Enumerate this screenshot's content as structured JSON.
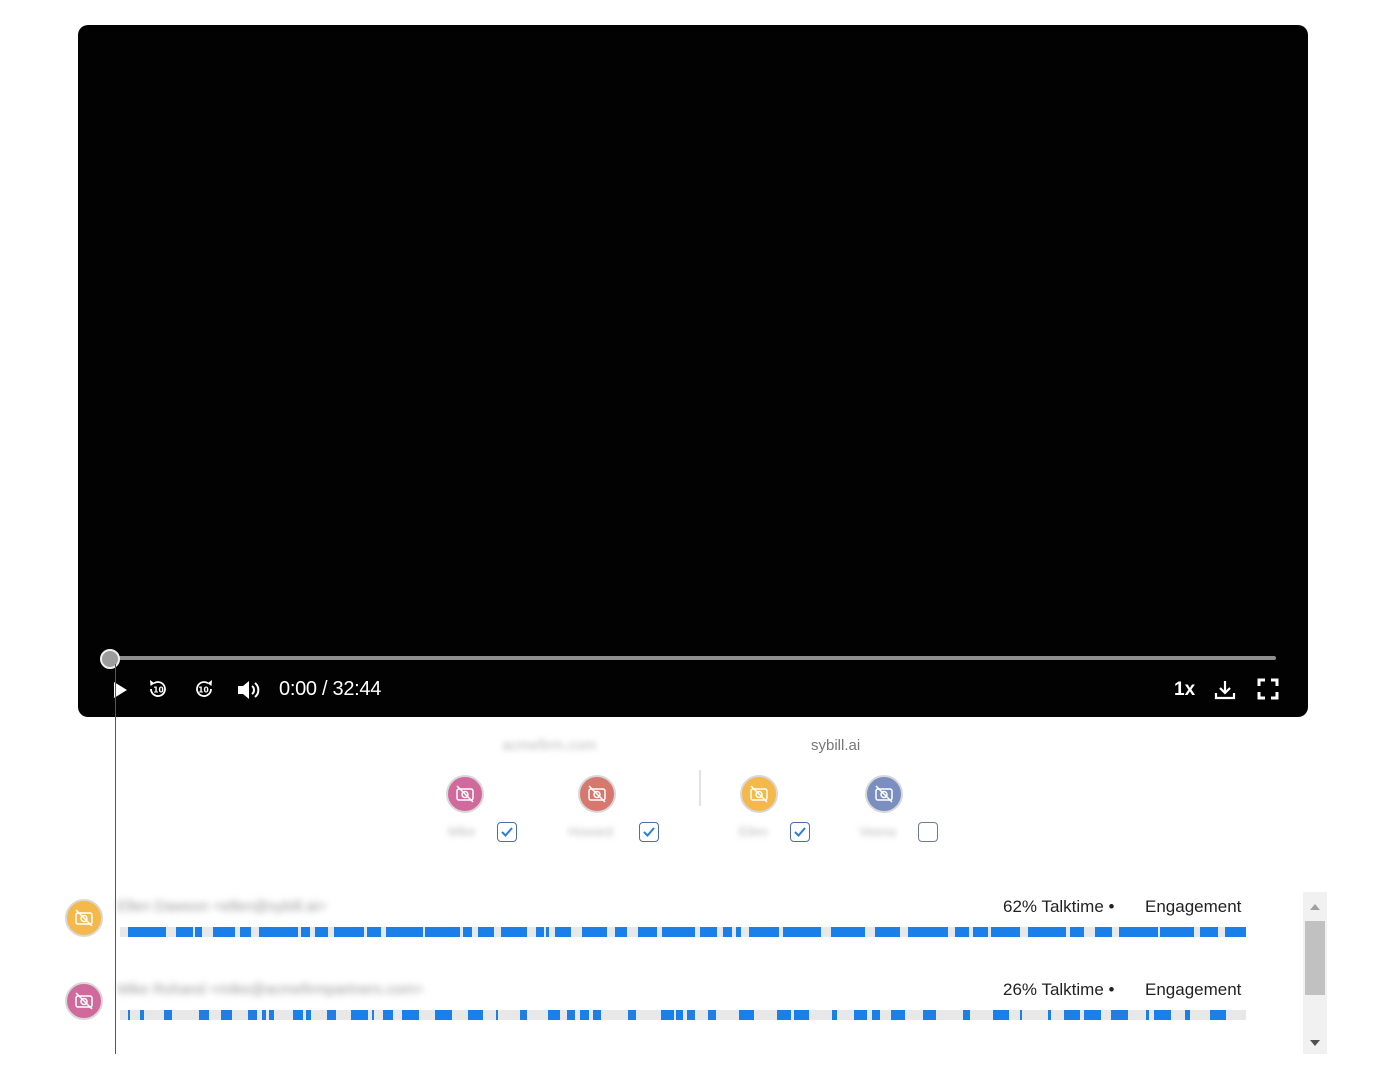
{
  "player": {
    "time_display": "0:00 / 32:44",
    "progress": 0,
    "speed": "1x",
    "icons": [
      "play-icon",
      "rewind-10-icon",
      "forward-10-icon",
      "volume-icon",
      "download-icon",
      "fullscreen-icon"
    ]
  },
  "orgs": {
    "left": "acmefirm.com",
    "right": "sybill.ai"
  },
  "participants": [
    {
      "name": "Mike",
      "color": "#d06a9c",
      "checked": true
    },
    {
      "name": "Howard",
      "color": "#d6786e",
      "checked": true
    },
    {
      "name": "Ellen",
      "color": "#f5b84a",
      "checked": true
    },
    {
      "name": "Veena",
      "color": "#7a8fbf",
      "checked": false
    }
  ],
  "tracks": [
    {
      "name": "Ellen Dawson <ellen@sybill.ai>",
      "color": "#f5b84a",
      "talktime": "62% Talktime",
      "engagement": "Engagement",
      "talktime_pct": 62
    },
    {
      "name": "Mike Rohand <mike@acmefirmpartners.com>",
      "color": "#d06a9c",
      "talktime": "26% Talktime",
      "engagement": "Engagement",
      "talktime_pct": 26
    }
  ]
}
